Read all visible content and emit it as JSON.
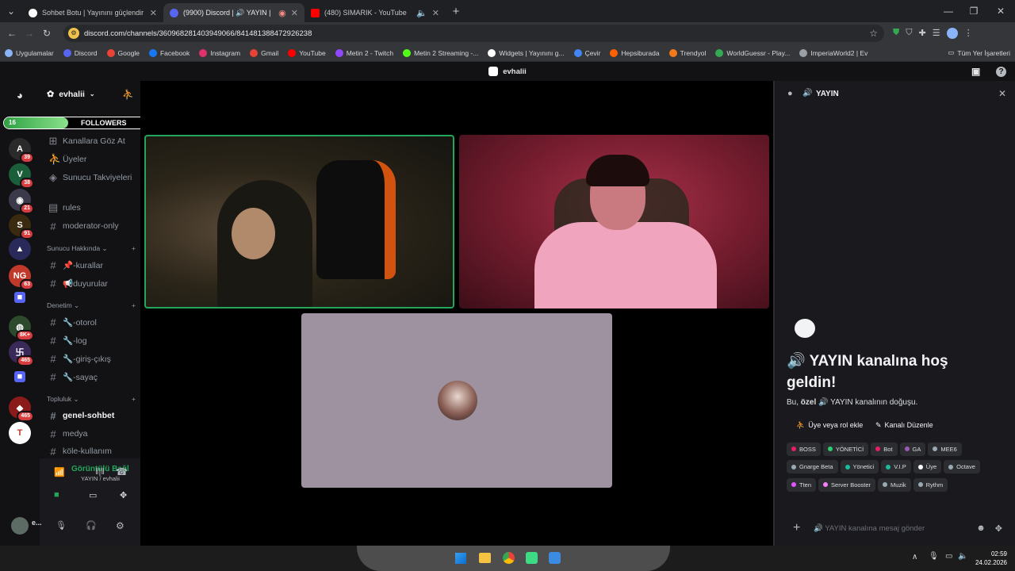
{
  "browser": {
    "tabs": [
      {
        "label": "Sohbet Botu | Yayınını güçlendir",
        "favicon_color": "#ffffff"
      },
      {
        "label": "(9900) Discord | 🔊 YAYIN |",
        "favicon_color": "#5865f2"
      },
      {
        "label": "(480) SIMARIK - YouTube",
        "favicon_color": "#ff0000"
      }
    ],
    "new_tab": "+",
    "url": "discord.com/channels/360968281403949066/841481388472926238",
    "bookmarks": [
      {
        "label": "Uygulamalar",
        "color": "#8ab4f8"
      },
      {
        "label": "Discord",
        "color": "#5865f2"
      },
      {
        "label": "Google",
        "color": "#ea4335"
      },
      {
        "label": "Facebook",
        "color": "#1877f2"
      },
      {
        "label": "Instagram",
        "color": "#e1306c"
      },
      {
        "label": "Gmail",
        "color": "#ea4335"
      },
      {
        "label": "YouTube",
        "color": "#ff0000"
      },
      {
        "label": "Metin 2 - Twitch",
        "color": "#9146ff"
      },
      {
        "label": "Metin 2 Streaming -...",
        "color": "#53fc18"
      },
      {
        "label": "Widgets | Yayınını g...",
        "color": "#ffffff"
      },
      {
        "label": "Çevir",
        "color": "#4285f4"
      },
      {
        "label": "Hepsiburada",
        "color": "#ff6000"
      },
      {
        "label": "Trendyol",
        "color": "#f27a1a"
      },
      {
        "label": "WorldGuessr - Play...",
        "color": "#34a853"
      },
      {
        "label": "ImperiaWorld2 | Ev",
        "color": "#9aa0a6"
      }
    ],
    "all_bookmarks": "Tüm Yer İşaretleri"
  },
  "discord": {
    "title": "evhalii",
    "server_name": "evhalii",
    "servers": [
      {
        "badge": "39",
        "color": "#2a2a2a",
        "glyph": "A"
      },
      {
        "badge": "38",
        "color": "#1b5e3a",
        "glyph": "V"
      },
      {
        "badge": "21",
        "color": "#3a3a4a",
        "glyph": "◉"
      },
      {
        "badge": "91",
        "color": "#3a2a10",
        "glyph": "S"
      },
      {
        "badge": "",
        "color": "#2a2a5a",
        "glyph": "▲"
      },
      {
        "badge": "63",
        "color": "#c0392b",
        "glyph": "NG"
      },
      {
        "badge": "",
        "color": "#5865f2",
        "glyph": "■"
      },
      {
        "badge": "8K+",
        "color": "#2d4a2d",
        "glyph": "◍"
      },
      {
        "badge": "465",
        "color": "#3a2a5a",
        "glyph": "卐"
      },
      {
        "badge": "",
        "color": "#5865f2",
        "glyph": "■"
      },
      {
        "badge": "465",
        "color": "#8b1a1a",
        "glyph": "◆"
      },
      {
        "badge": "",
        "color": "#ffffff",
        "glyph": "T"
      }
    ],
    "channels": [
      {
        "label": "Kanallara Göz At",
        "icon": "browse-icon"
      },
      {
        "label": "Üyeler",
        "icon": "members-icon"
      },
      {
        "label": "Sunucu Takviyeleri",
        "icon": "boost-icon"
      },
      {
        "label": "rules",
        "icon": "rules-icon"
      },
      {
        "label": "moderator-only",
        "icon": "hash-icon"
      },
      {
        "label": "📌-kurallar",
        "icon": "hash-icon"
      },
      {
        "label": "📢duyurular",
        "icon": "hash-icon"
      },
      {
        "label": "🔧-otorol",
        "icon": "hash-icon"
      },
      {
        "label": "🔧-log",
        "icon": "hash-icon"
      },
      {
        "label": "🔧-giriş-çıkış",
        "icon": "hash-icon"
      },
      {
        "label": "🔧-sayaç",
        "icon": "hash-icon"
      },
      {
        "label": "genel-sohbet",
        "icon": "hash-icon"
      },
      {
        "label": "medya",
        "icon": "hash-icon"
      },
      {
        "label": "köle-kullanım",
        "icon": "hash-icon"
      }
    ],
    "categories": [
      "Sunucu Hakkında",
      "Denetim",
      "Topluluk"
    ],
    "voice": {
      "status": "Görüntülü Bağl",
      "channel": "YAYIN / evhalii"
    },
    "user": {
      "name": "e..."
    },
    "followers": {
      "current": "16",
      "label": "FOLLOWERS",
      "goal": "50",
      "progress": 0.32
    }
  },
  "panel": {
    "title": "YAYIN",
    "welcome_title": "🔊 YAYIN kanalına hoş geldin!",
    "welcome_prefix": "Bu, ",
    "welcome_bold": "özel",
    "welcome_suffix": " 🔊 YAYIN kanalının doğuşu.",
    "add_members": "Üye veya rol ekle",
    "edit_channel": "Kanalı Düzenle",
    "roles": [
      {
        "label": "BOSS",
        "color": "#e91e63"
      },
      {
        "label": "YÖNETİCİ",
        "color": "#2ecc71"
      },
      {
        "label": "Bot",
        "color": "#e91e63"
      },
      {
        "label": "GA",
        "color": "#9b59b6"
      },
      {
        "label": "MEE6",
        "color": "#99aab5"
      },
      {
        "label": "Gnarge Beta",
        "color": "#99aab5"
      },
      {
        "label": "Yönetici",
        "color": "#1abc9c"
      },
      {
        "label": "V.I.P",
        "color": "#1abc9c"
      },
      {
        "label": "Üye",
        "color": "#ffffff"
      },
      {
        "label": "Octave",
        "color": "#99aab5"
      },
      {
        "label": "Tten",
        "color": "#e056fd"
      },
      {
        "label": "Server Booster",
        "color": "#f47fff"
      },
      {
        "label": "Muzik",
        "color": "#99aab5"
      },
      {
        "label": "Rythm",
        "color": "#99aab5"
      }
    ],
    "message_placeholder": "🔊 YAYIN kanalına mesaj gönder"
  },
  "taskbar": {
    "time": "02:59",
    "date": "24.02.2026"
  }
}
